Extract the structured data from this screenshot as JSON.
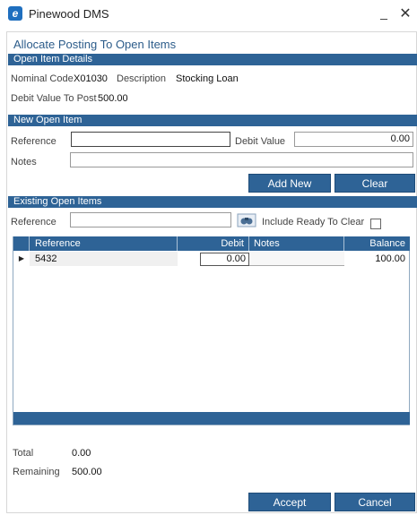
{
  "window": {
    "icon_glyph": "e",
    "title": "Pinewood DMS",
    "min_glyph": "_",
    "close_glyph": "✕"
  },
  "dialog": {
    "title": "Allocate Posting To Open Items"
  },
  "open_item_details": {
    "header": "Open Item Details",
    "nominal_code_label": "Nominal Code",
    "nominal_code": "X01030",
    "description_label": "Description",
    "description": "Stocking Loan",
    "debit_value_label": "Debit Value To Post",
    "debit_value": "500.00"
  },
  "new_open_item": {
    "header": "New Open Item",
    "reference_label": "Reference",
    "reference_value": "",
    "debit_value_label": "Debit Value",
    "debit_value": "0.00",
    "notes_label": "Notes",
    "notes_value": "",
    "add_new_label": "Add New",
    "clear_label": "Clear"
  },
  "existing_open_items": {
    "header": "Existing Open Items",
    "reference_label": "Reference",
    "reference_value": "",
    "include_ready_label": "Include Ready To Clear",
    "include_ready_checked": false,
    "columns": [
      "Reference",
      "Debit",
      "Notes",
      "Balance"
    ],
    "rows": [
      {
        "indicator": "▶",
        "reference": "5432",
        "debit": "0.00",
        "notes": "",
        "balance": "100.00"
      }
    ]
  },
  "totals": {
    "total_label": "Total",
    "total_value": "0.00",
    "remaining_label": "Remaining",
    "remaining_value": "500.00"
  },
  "footer": {
    "accept_label": "Accept",
    "cancel_label": "Cancel"
  },
  "colors": {
    "accent": "#2e6396",
    "title_text": "#2c5c8a"
  },
  "icons": {
    "app": "app-logo-icon",
    "search": "search-binoculars-icon",
    "row_indicator": "current-row-arrow-icon"
  }
}
